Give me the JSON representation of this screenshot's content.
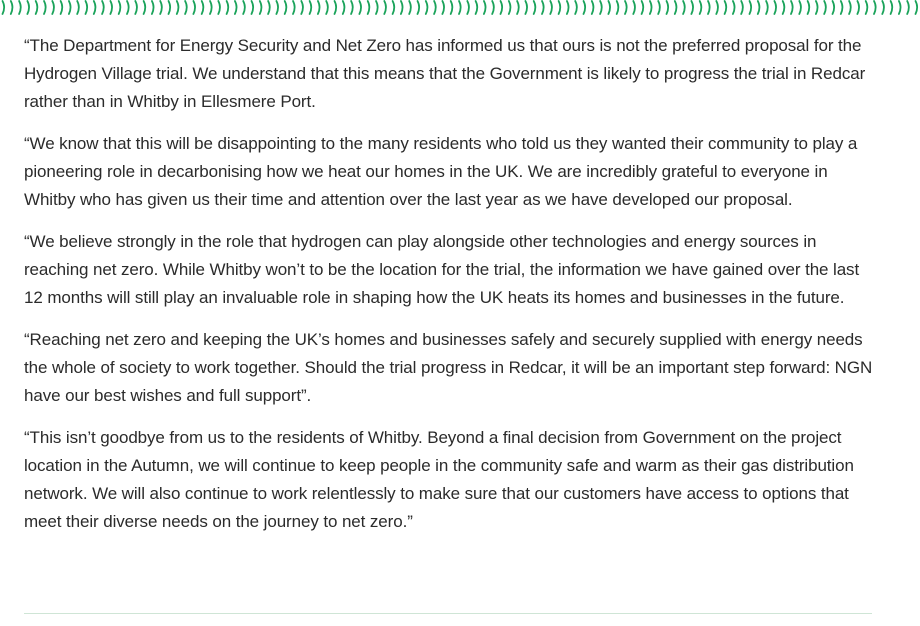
{
  "colors": {
    "accent": "#1aa35a",
    "text": "#2b2b2b",
    "divider": "#cfe5d6",
    "background": "#ffffff"
  },
  "decoration": {
    "top_border_icon": "green-wavy-pattern"
  },
  "article": {
    "paragraphs": [
      "“The Department for Energy Security and Net Zero has informed us that ours is not the preferred proposal for the Hydrogen Village trial. We understand that this means that the Government is likely to progress the trial in Redcar rather than in Whitby in Ellesmere Port.",
      "“We know that this will be disappointing to the many residents who told us they wanted their community to play a pioneering role in decarbonising how we heat our homes in the UK. We are incredibly grateful to everyone in Whitby who has given us their time and attention over the last year as we have developed our proposal.",
      "“We believe strongly in the role that hydrogen can play alongside other technologies and energy sources in reaching net zero. While Whitby won’t to be the location for the trial, the information we have gained over the last 12 months will still play an invaluable role in shaping how the UK heats its homes and businesses in the future.",
      "“Reaching net zero and keeping the UK’s homes and businesses safely and securely supplied with energy needs the whole of society to work together. Should the trial progress in Redcar, it will be an important step forward: NGN have our best wishes and full support”.",
      "“This isn’t goodbye from us to the residents of Whitby. Beyond a final decision from Government on the project location in the Autumn, we will continue to keep people in the community safe and warm as their gas distribution network. We will also continue to work relentlessly to make sure that our customers have access to options that meet their diverse needs on the journey to net zero.”"
    ]
  }
}
